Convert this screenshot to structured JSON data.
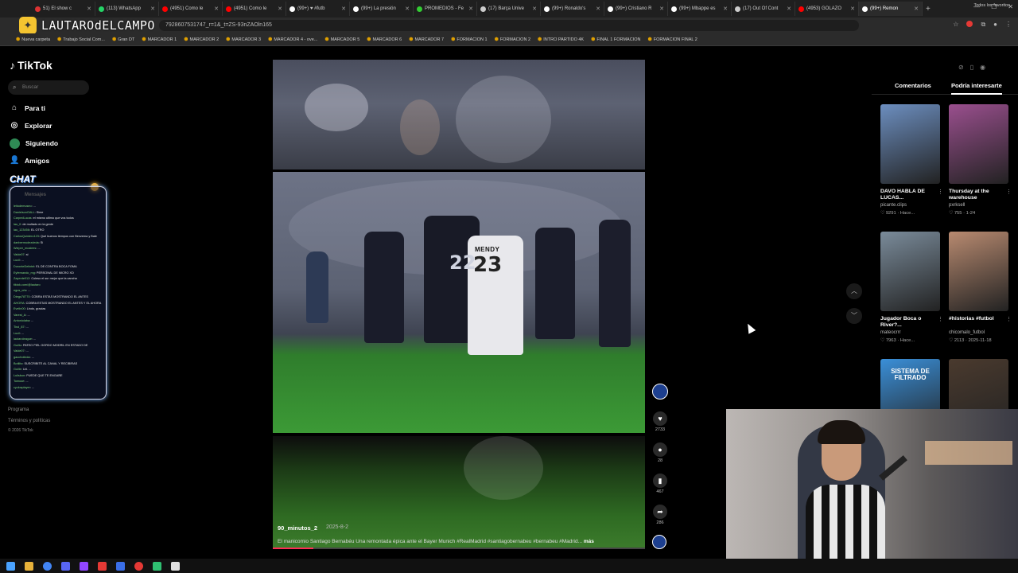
{
  "browser": {
    "tabs": [
      {
        "label": "51) El show c",
        "color": "#d33"
      },
      {
        "label": "(113) WhatsApp",
        "color": "#25d366"
      },
      {
        "label": "(4951) Como le",
        "color": "#f00"
      },
      {
        "label": "(4951) Como le",
        "color": "#f00"
      },
      {
        "label": "(99+) ♥ #futb",
        "color": "#fff"
      },
      {
        "label": "(99+) La presión",
        "color": "#fff"
      },
      {
        "label": "PROMEDIOS - Fe",
        "color": "#3c3"
      },
      {
        "label": "(17) Barça Unive",
        "color": "#ccc"
      },
      {
        "label": "(99+) Ronaldo's",
        "color": "#fff"
      },
      {
        "label": "(99+) Cristiano R",
        "color": "#fff"
      },
      {
        "label": "(99+) Mbappe es",
        "color": "#fff"
      },
      {
        "label": "(17) Out Of Cont",
        "color": "#ccc"
      },
      {
        "label": "(4953) GOLAZO",
        "color": "#f00"
      },
      {
        "label": "(99+) Remon",
        "color": "#fff",
        "active": true
      }
    ],
    "url": "7928607531747_r=1&_t=ZS-93nZAOln165",
    "bookmarks": [
      "Nueva carpeta",
      "Trabajo Social Com...",
      "Gran DT",
      "MARCADOR 1",
      "MARCADOR 2",
      "MARCADOR 3",
      "MARCADOR 4 - ove...",
      "MARCADOR 5",
      "MARCADOR 6",
      "MARCADOR 7",
      "FORMACION 1",
      "FORMACION 2",
      "INTRO PARTIDO 4K",
      "FINAL 1 FORMACION",
      "FORMACION FINAL 2"
    ],
    "bookmarks_right": "Todos los favoritos"
  },
  "overlay": {
    "streamer_name": "LAUTAROdELCAMPO"
  },
  "sidebar": {
    "logo": "TikTok",
    "search_placeholder": "Buscar",
    "nav": [
      {
        "label": "Para ti",
        "icon": "home-icon"
      },
      {
        "label": "Explorar",
        "icon": "compass-icon"
      },
      {
        "label": "Siguiendo",
        "icon": "avatar"
      },
      {
        "label": "Amigos",
        "icon": "friends-icon"
      }
    ],
    "chat_title": "CHAT",
    "chat_ghost": "Mensajes",
    "chat_lines": [
      {
        "user": "leitodemuseo",
        "text": ": ..."
      },
      {
        "user": "DanielsonGALL",
        "text": ": Sime"
      },
      {
        "user": "CarpedLucas",
        "text": ": el mismo ultimo que vos todos"
      },
      {
        "user": "lau_0",
        "text": ": de multado en la gente"
      },
      {
        "user": "lau_123456",
        "text": ": EL OTRO"
      },
      {
        "user": "CarlosQuintero123",
        "text": ": Qué buenos tiempos con Benzema y Bale"
      },
      {
        "user": "danbermudezdeda",
        "text": ": Si"
      },
      {
        "user": "Wieper_mcalees",
        "text": ": ..."
      },
      {
        "user": "Valde07",
        "text": ": si"
      },
      {
        "user": "Lucil",
        "text": ": ..."
      },
      {
        "user": "DuronteDelintel",
        "text": ": EL DE CONTRA BOCA FOMA"
      },
      {
        "user": "Eyfernando_mg",
        "text": ": PERSONAL DE MICRO XD"
      },
      {
        "user": "Zayerde012",
        "text": ": Coleso el sur mejor que la cancha"
      },
      {
        "user": "tiktok.com/@lautaro",
        "text": ""
      },
      {
        "user": "ngus_cris",
        "text": ": ..."
      },
      {
        "user": "Diego78770",
        "text": ": COBRA ESTAS MOSTRANDO EL ANTES"
      },
      {
        "user": "AHORA",
        "text": ": COBRA ESTAS MOSTRANDO EL ANTES Y EL AHORA"
      },
      {
        "user": "Evelin00",
        "text": ": Lindo, gracias"
      },
      {
        "user": "Varest_A",
        "text": ": ..."
      },
      {
        "user": "Antoniolaba",
        "text": ": ..."
      },
      {
        "user": "Tirol_87",
        "text": ": ..."
      },
      {
        "user": "Lucil",
        "text": ": ..."
      },
      {
        "user": "lautaroleague",
        "text": ": ..."
      },
      {
        "user": "Guillo",
        "text": ": PATEO PIEL GORDO MODRIL EN ESTADO DE"
      },
      {
        "user": "Valde07",
        "text": ": ..."
      },
      {
        "user": "gaucholinda",
        "text": ": ..."
      },
      {
        "user": "Botilito",
        "text": ": SUSCRIBITE AL CANAL Y RECIBIRAS"
      },
      {
        "user": "Guille",
        "text": ": Ud. ..."
      },
      {
        "user": "Lulisbon",
        "text": ": PUEDE QUE TE ENGAÑE"
      },
      {
        "user": "Tomuse",
        "text": ": ..."
      },
      {
        "user": "cyclosplayer",
        "text": ": ..."
      }
    ],
    "footer": [
      "Programa",
      "Términos y políticas",
      "© 2026 TikTok"
    ]
  },
  "video": {
    "author": "90_minutos_2",
    "date": "2025-8-2",
    "caption": "El manicomio Santiago Bernabéu Una remontada épica ante el Bayer Munich #RealMadrid #santiagobernabeu #bernabeu #Madrid...",
    "more_label": "más",
    "jersey_numbers": [
      "22",
      "23"
    ],
    "jersey_name": "MENDY",
    "progress": 0.11,
    "actions": [
      {
        "name": "like",
        "count": "2733"
      },
      {
        "name": "comment",
        "count": "28"
      },
      {
        "name": "save",
        "count": "467"
      },
      {
        "name": "share",
        "count": "286"
      }
    ]
  },
  "right_panel": {
    "tabs": [
      "Comentarios",
      "Podría interesarte"
    ],
    "active_tab": 1,
    "cards": [
      {
        "title": "DAVO HABLA DE LUCAS...",
        "author": "picante.clips",
        "likes": "9291",
        "date": "Hace...",
        "thumb": "#6c8ebf"
      },
      {
        "title": "Thursday at the warehouse",
        "author": "pxrksell",
        "likes": "755",
        "date": "1-24",
        "thumb": "#9a4f8e"
      },
      {
        "title": "Jugador Boca o River?...",
        "author": "mateocrrr",
        "likes": "7963",
        "date": "Hace...",
        "thumb": "#7a8b9a"
      },
      {
        "title": "#historias #futbol",
        "author": "chicomalo_futbol",
        "likes": "2113",
        "date": "2025-11-18",
        "thumb": "#b88a70"
      },
      {
        "title": "SISTEMA DE FILTRADO",
        "author": "",
        "likes": "",
        "date": "",
        "thumb": "#3a8fd8"
      },
      {
        "title": "",
        "author": "",
        "likes": "",
        "date": "",
        "thumb": "#4a3a2e"
      }
    ]
  },
  "colors": {
    "accent": "#fe2c55",
    "chat_glow": "#7ab3ff"
  }
}
